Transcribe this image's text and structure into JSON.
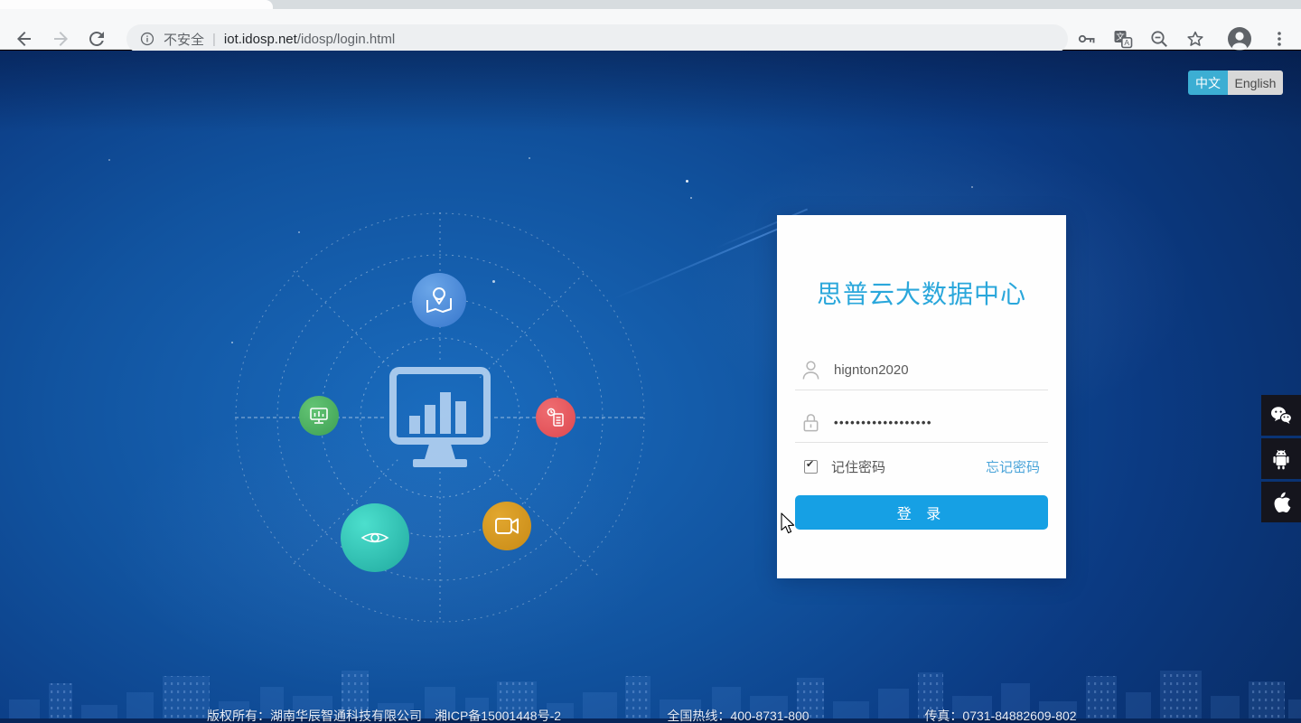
{
  "browser": {
    "security_label": "不安全",
    "separator": "|",
    "url_domain": "iot.idosp.net",
    "url_path": "/idosp/login.html"
  },
  "language": {
    "zh": "中文",
    "en": "English"
  },
  "login": {
    "title": "思普云大数据中心",
    "username": "hignton2020",
    "password_value": "••••••••••••••••••",
    "remember_label": "记住密码",
    "forgot_label": "忘记密码",
    "submit_label": "登 录"
  },
  "footer": {
    "copyright": "版权所有：湖南华辰智通科技有限公司　湘ICP备15001448号-2",
    "hotline": "全国热线：400-8731-800",
    "fax": "传真：0731-84882609-802"
  },
  "icons": {
    "hub_center": "monitor-bar-chart-icon",
    "hub_satellites": [
      "map-pin-icon",
      "monitor-icon",
      "report-clock-icon",
      "eye-icon",
      "video-camera-icon"
    ],
    "social": [
      "wechat-icon",
      "android-icon",
      "apple-icon"
    ]
  },
  "colors": {
    "accent_cyan": "#2aa7db",
    "button_blue": "#16a0e4",
    "link_blue": "#4aa4d9",
    "lang_active_bg": "#3caed3",
    "satellite_blue": "#4e92dd",
    "satellite_green": "#52b768",
    "satellite_red": "#ea5a60",
    "satellite_teal": "#38cfc0",
    "satellite_orange": "#d79a22",
    "bg_center": "#1a6cbe",
    "bg_edge": "#082a61",
    "footer_text": "#e6ecf5"
  }
}
